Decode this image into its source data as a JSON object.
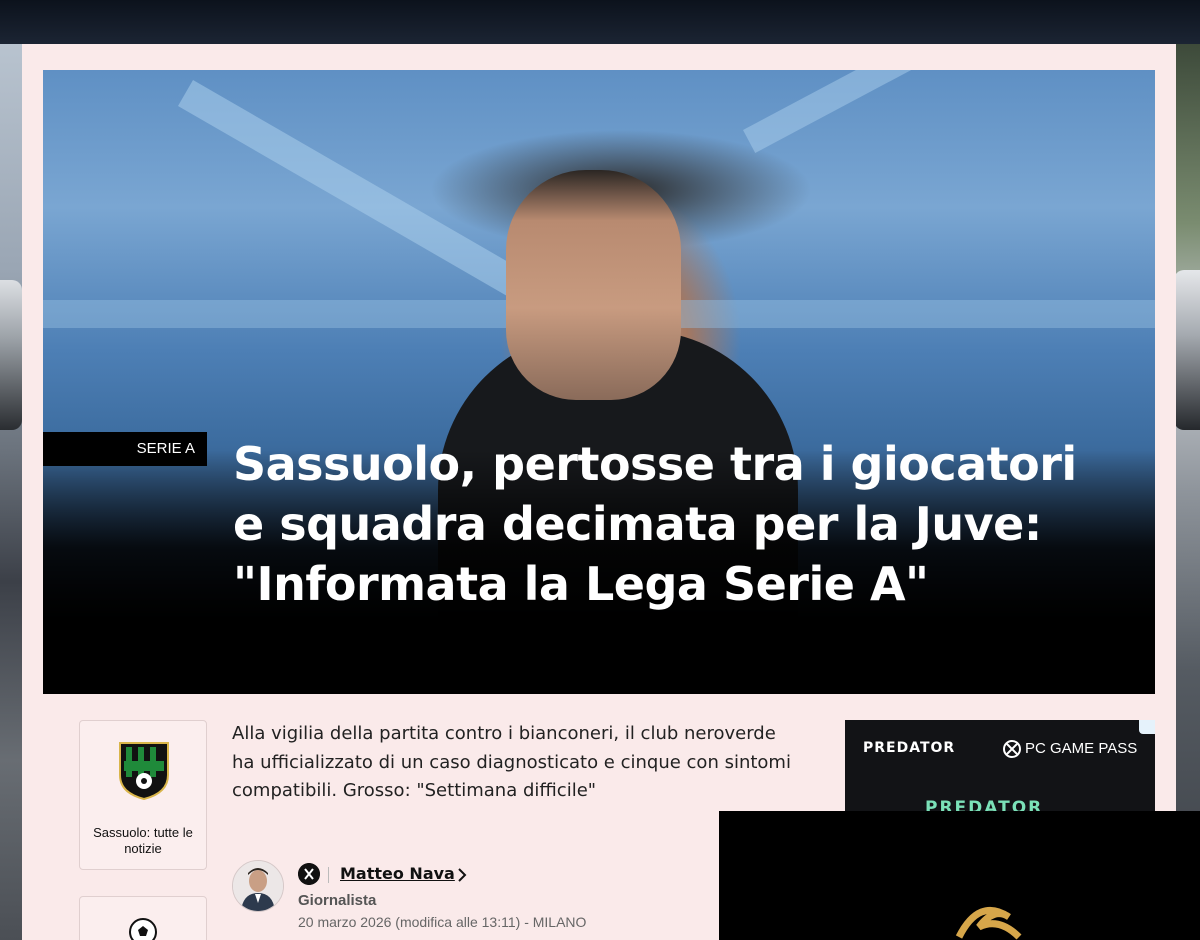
{
  "hero": {
    "category": "SERIE A",
    "title": "Sassuolo, pertosse tra i giocatori e squadra decimata per la Juve: \"Informata la Lega Serie A\""
  },
  "team_card": {
    "label": "Sassuolo: tutte le notizie"
  },
  "summary": "Alla vigilia della partita contro i bianconeri, il club neroverde ha ufficializzato di un caso diagnosticato e cinque con sintomi compatibili. Grosso: \"Settimana difficile\"",
  "author": {
    "name": "Matteo Nava",
    "role": "Giornalista",
    "date": "20 marzo 2026 (modifica alle 13:11) - MILANO"
  },
  "ad": {
    "brand": "PREDATOR",
    "partner": "PC GAME PASS",
    "headline": "PREDATOR"
  },
  "colors": {
    "page_background": "#faeaea",
    "hero_overlay": "#000000",
    "team_green": "#1f8a3a"
  }
}
